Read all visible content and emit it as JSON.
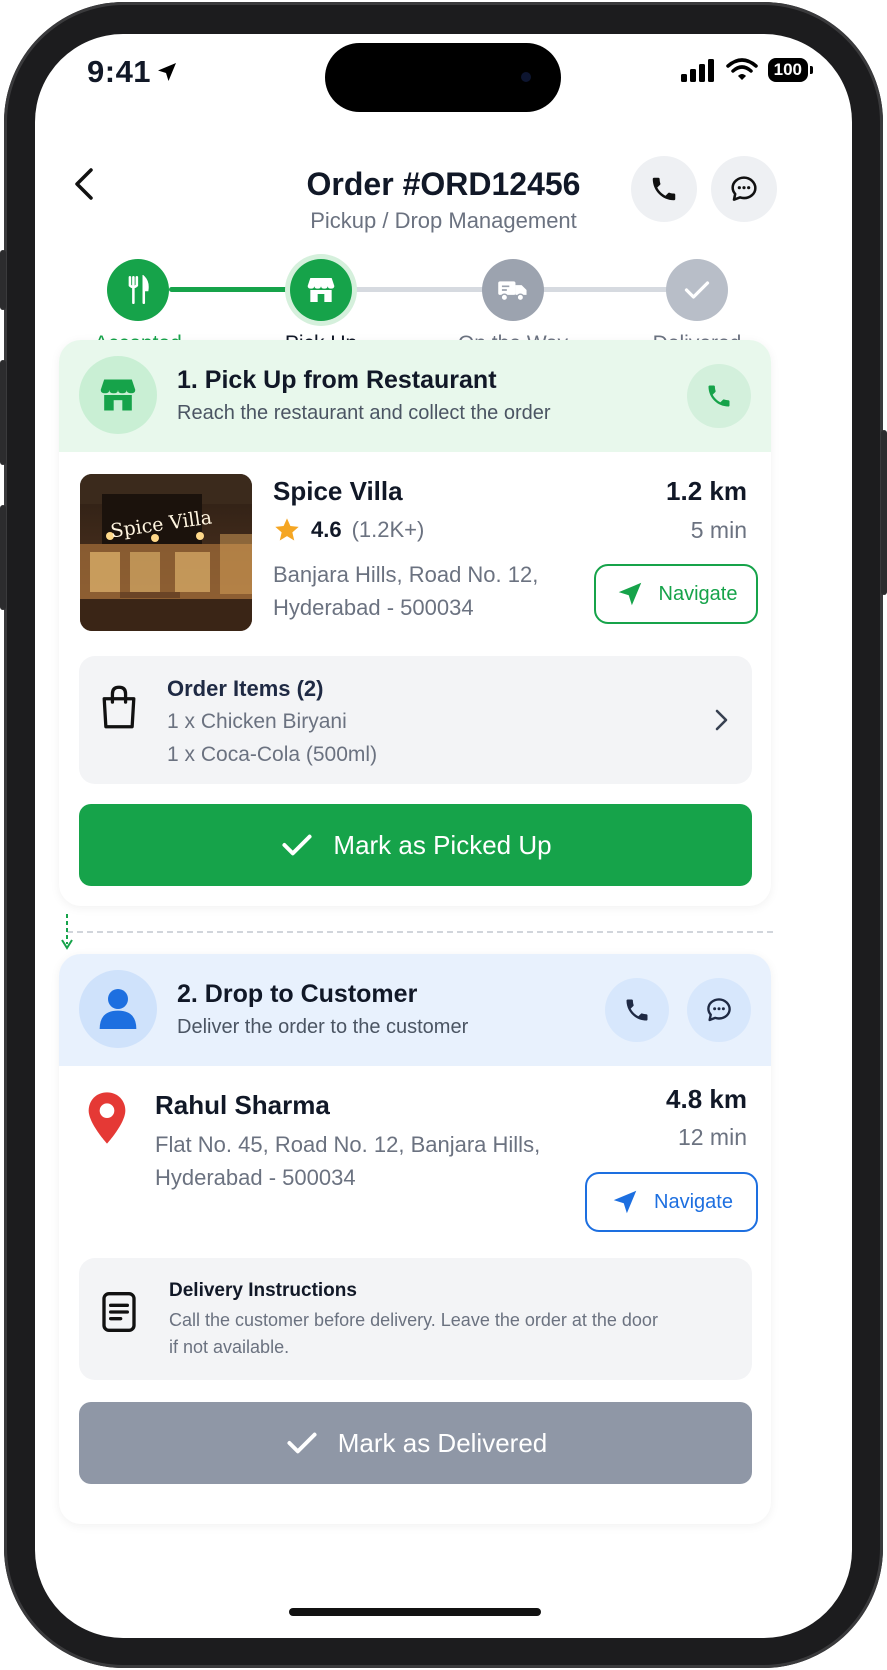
{
  "status_bar": {
    "time": "9:41",
    "battery": "100"
  },
  "header": {
    "title": "Order #ORD12456",
    "subtitle": "Pickup / Drop Management"
  },
  "stepper": {
    "steps": [
      {
        "label": "Accepted",
        "state": "done"
      },
      {
        "label": "Pick Up",
        "state": "active"
      },
      {
        "label": "On the Way",
        "state": "pending"
      },
      {
        "label": "Delivered",
        "state": "pending"
      }
    ]
  },
  "pickup": {
    "title": "1. Pick Up from Restaurant",
    "subtitle": "Reach the restaurant and collect the order",
    "restaurant": {
      "name": "Spice Villa",
      "sign_text": "Spice Villa",
      "rating": "4.6",
      "reviews": "(1.2K+)",
      "address_line1": "Banjara Hills, Road No. 12,",
      "address_line2": "Hyderabad - 500034",
      "distance": "1.2 km",
      "eta": "5 min",
      "navigate_label": "Navigate"
    },
    "items": {
      "heading": "Order Items (2)",
      "lines": [
        "1 x Chicken Biryani",
        "1 x Coca-Cola (500ml)"
      ]
    },
    "action_label": "Mark as Picked Up"
  },
  "drop": {
    "title": "2. Drop to Customer",
    "subtitle": "Deliver the order to the customer",
    "customer": {
      "name": "Rahul Sharma",
      "address_line1": "Flat No. 45, Road No. 12, Banjara Hills,",
      "address_line2": "Hyderabad - 500034",
      "distance": "4.8 km",
      "eta": "12 min",
      "navigate_label": "Navigate"
    },
    "instructions": {
      "heading": "Delivery Instructions",
      "line1": "Call the customer before delivery. Leave the order at the door",
      "line2": "if not available."
    },
    "action_label": "Mark as Delivered"
  },
  "colors": {
    "green": "#16a34a",
    "green_light": "#e8f8ec",
    "blue": "#1d6fe0",
    "blue_light": "#e8f1fd",
    "gray_button": "#8f97a6",
    "pending_step": "#9ca3af",
    "star": "#f5a623",
    "pin": "#e53935"
  },
  "icons": [
    "back-icon",
    "phone-icon",
    "chat-icon",
    "fork-knife-icon",
    "store-icon",
    "truck-icon",
    "check-icon",
    "star-icon",
    "navigate-arrow-icon",
    "shopping-bag-icon",
    "chevron-right-icon",
    "person-icon",
    "map-pin-icon",
    "document-icon"
  ]
}
